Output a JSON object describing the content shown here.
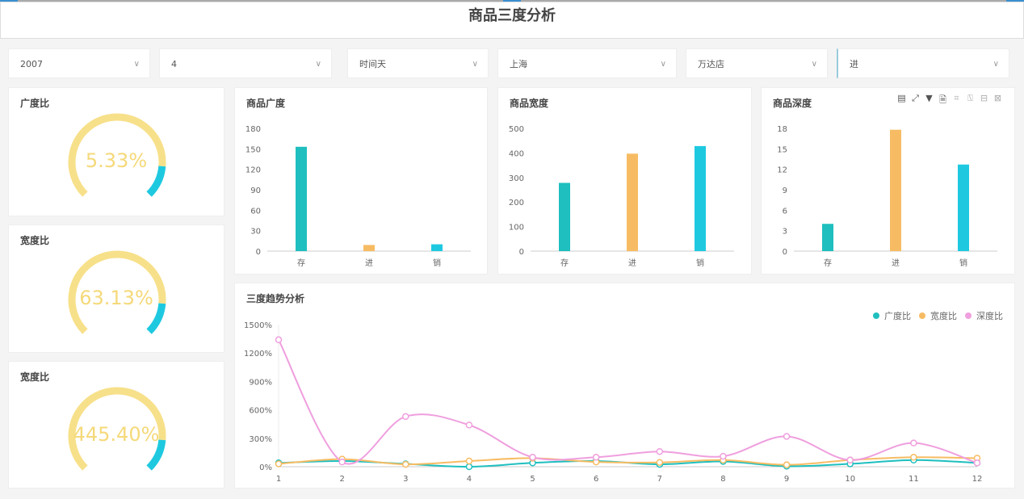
{
  "title": "商品三度分析",
  "filters": [
    {
      "value": "2007"
    },
    {
      "value": "4"
    },
    {
      "value": "时间天"
    },
    {
      "value": "上海"
    },
    {
      "value": "万达店"
    },
    {
      "value": "进"
    }
  ],
  "gauges": [
    {
      "label": "广度比",
      "value": "5.33%"
    },
    {
      "label": "宽度比",
      "value": "63.13%"
    },
    {
      "label": "宽度比",
      "value": "445.40%"
    }
  ],
  "colors": {
    "teal": "#1fbfbf",
    "orange": "#f7bc63",
    "cyan": "#1ec9e0",
    "pink": "#ef9fde",
    "gauge_track": "#f7e08a"
  },
  "toolbar_icons": [
    "data-view-icon",
    "fullscreen-icon",
    "filter-icon",
    "export-icon",
    "zoom-select-icon",
    "zoom-reset-icon",
    "restore-icon",
    "close-icon"
  ],
  "chart_data": [
    {
      "type": "bar",
      "title": "商品广度",
      "categories": [
        "存",
        "进",
        "销"
      ],
      "values": [
        153,
        9,
        10
      ],
      "ylim": [
        0,
        180
      ],
      "yticks": [
        0,
        30,
        60,
        90,
        120,
        150,
        180
      ],
      "bar_colors": [
        "#1fbfbf",
        "#f7bc63",
        "#1ec9e0"
      ]
    },
    {
      "type": "bar",
      "title": "商品宽度",
      "categories": [
        "存",
        "进",
        "销"
      ],
      "values": [
        278,
        397,
        428
      ],
      "ylim": [
        0,
        500
      ],
      "yticks": [
        0,
        100,
        200,
        300,
        400,
        500
      ],
      "bar_colors": [
        "#1fbfbf",
        "#f7bc63",
        "#1ec9e0"
      ]
    },
    {
      "type": "bar",
      "title": "商品深度",
      "categories": [
        "存",
        "进",
        "销"
      ],
      "values": [
        4,
        17.8,
        12.7
      ],
      "ylim": [
        0,
        18
      ],
      "yticks": [
        0,
        3,
        6,
        9,
        12,
        15,
        18
      ],
      "bar_colors": [
        "#1fbfbf",
        "#f7bc63",
        "#1ec9e0"
      ]
    },
    {
      "type": "line",
      "title": "三度趋势分析",
      "x": [
        1,
        2,
        3,
        4,
        5,
        6,
        7,
        8,
        9,
        10,
        11,
        12
      ],
      "ylim": [
        0,
        1500
      ],
      "yticks": [
        "0%",
        "300%",
        "600%",
        "900%",
        "1200%",
        "1500%"
      ],
      "legend": "top-right",
      "series": [
        {
          "name": "广度比",
          "color": "#1fbfbf",
          "values": [
            40,
            60,
            30,
            0,
            40,
            60,
            25,
            55,
            5,
            30,
            70,
            40
          ]
        },
        {
          "name": "宽度比",
          "color": "#f7bc63",
          "values": [
            30,
            80,
            25,
            60,
            90,
            50,
            45,
            70,
            20,
            70,
            100,
            90
          ]
        },
        {
          "name": "深度比",
          "color": "#ef9fde",
          "values": [
            1340,
            50,
            530,
            440,
            100,
            100,
            160,
            110,
            320,
            70,
            250,
            40
          ]
        }
      ]
    }
  ]
}
